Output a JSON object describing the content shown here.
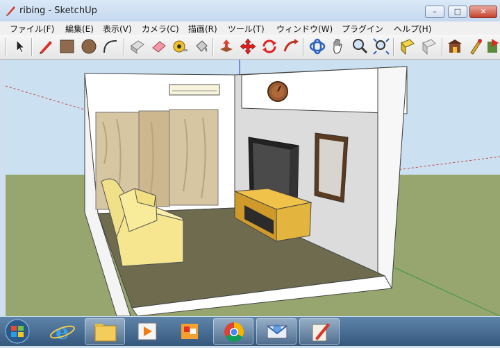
{
  "window": {
    "title": "ribing - SketchUp",
    "minimize_glyph": "–",
    "maximize_glyph": "□",
    "close_glyph": "✕"
  },
  "menu": [
    {
      "label": "ファイル(F)"
    },
    {
      "label": "編集(E)"
    },
    {
      "label": "表示(V)"
    },
    {
      "label": "カメラ(C)"
    },
    {
      "label": "描画(R)"
    },
    {
      "label": "ツール(T)"
    },
    {
      "label": "ウィンドウ(W)"
    },
    {
      "label": "プラグイン"
    },
    {
      "label": "ヘルプ(H)"
    }
  ],
  "toolbar": {
    "tools": [
      "select-icon",
      "pencil-icon",
      "rectangle-icon",
      "circle-icon",
      "arc-icon",
      "eraser-box-icon",
      "eraser-icon",
      "tape-measure-icon",
      "paint-bucket-icon",
      "push-pull-icon",
      "move-icon",
      "rotate-icon",
      "follow-me-icon",
      "orbit-icon",
      "pan-icon",
      "zoom-icon",
      "zoom-extents-icon",
      "previous-view-icon",
      "next-view-icon",
      "warehouse-icon",
      "extension-icon",
      "share-model-icon"
    ]
  },
  "taskbar": {
    "items": [
      "windows-start-icon",
      "internet-explorer-icon",
      "file-explorer-icon",
      "media-player-icon",
      "paint-app-icon",
      "chrome-icon",
      "thunderbird-icon",
      "sketchup-icon"
    ]
  },
  "colors": {
    "sky": "#cbe0f0",
    "ground": "#97a56e",
    "floor": "#6e6b4f",
    "wall": "#ffffff",
    "curtain": "#d7c6a2",
    "sofa": "#f5e68f",
    "tv_stand": "#e3b43e"
  }
}
